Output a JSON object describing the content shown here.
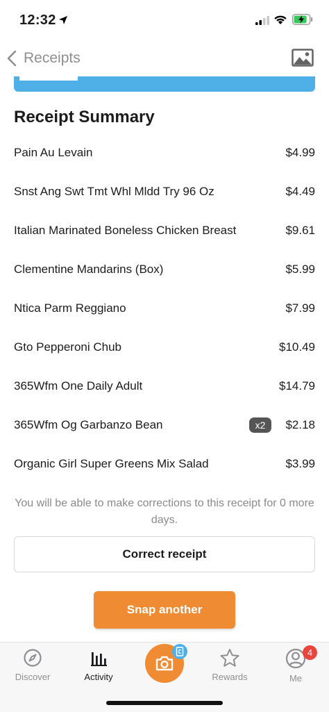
{
  "status_bar": {
    "time": "12:32",
    "icons": [
      "location-arrow-icon",
      "signal-icon",
      "wifi-icon",
      "battery-charging-icon"
    ]
  },
  "nav": {
    "back_label": "Receipts",
    "right_icon": "image-gallery-icon"
  },
  "colors": {
    "accent_orange": "#ef8c33",
    "banner_blue": "#4fb0e8",
    "badge_red": "#e8453c"
  },
  "summary": {
    "title": "Receipt Summary",
    "items": [
      {
        "name": "Pain Au Levain",
        "price": "$4.99"
      },
      {
        "name": "Snst Ang Swt Tmt Whl Mldd Try 96 Oz",
        "price": "$4.49"
      },
      {
        "name": "Italian Marinated Boneless Chicken Breast",
        "price": "$9.61"
      },
      {
        "name": "Clementine Mandarins (Box)",
        "price": "$5.99"
      },
      {
        "name": "Ntica Parm Reggiano",
        "price": "$7.99"
      },
      {
        "name": "Gto Pepperoni Chub",
        "price": "$10.49"
      },
      {
        "name": "365Wfm One Daily Adult",
        "price": "$14.79"
      },
      {
        "name": "365Wfm Og Garbanzo Bean",
        "price": "$2.18",
        "quantity": "x2"
      },
      {
        "name": "Organic Girl Super Greens Mix Salad",
        "price": "$3.99"
      }
    ]
  },
  "note": "You will be able to make corrections to this receipt for 0 more days.",
  "buttons": {
    "correct": "Correct receipt",
    "snap_another": "Snap another"
  },
  "tab_bar": {
    "discover": "Discover",
    "activity": "Activity",
    "rewards": "Rewards",
    "me": "Me",
    "me_badge": "4",
    "active_tab": "activity"
  }
}
